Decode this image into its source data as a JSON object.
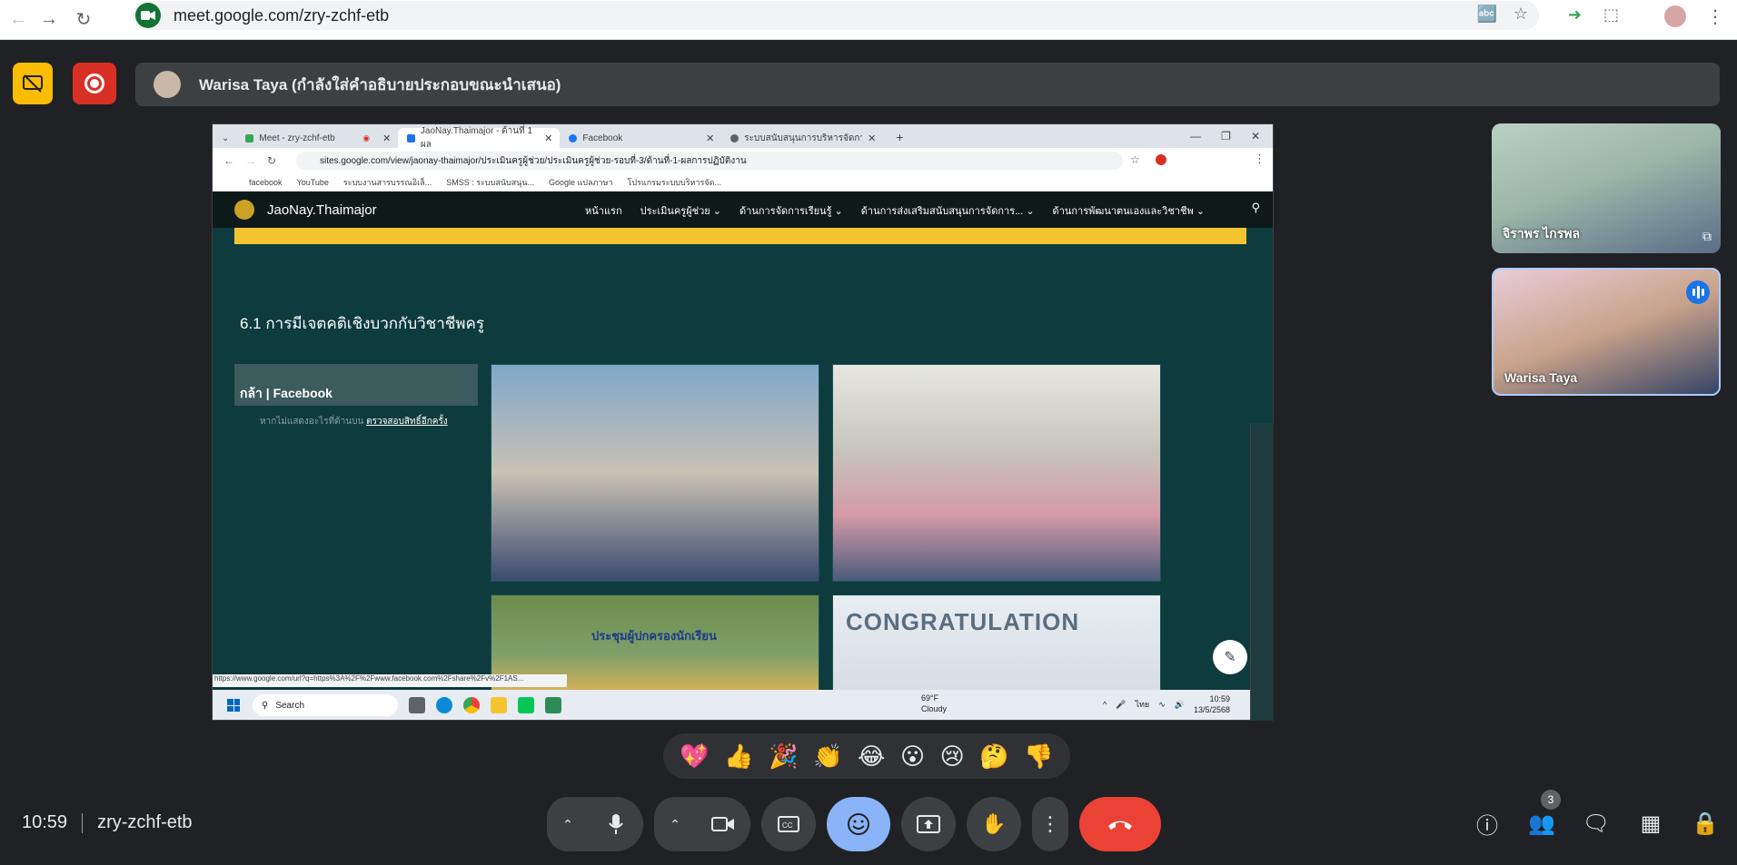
{
  "browser": {
    "url": "meet.google.com/zry-zchf-etb"
  },
  "presenter": {
    "banner_text": "Warisa Taya (กำลังใส่คำอธิบายประกอบขณะนำเสนอ)"
  },
  "shared_screen": {
    "tabs": [
      {
        "label": "Meet - zry-zchf-etb",
        "color": "#34a853"
      },
      {
        "label": "JaoNay.Thaimajor - ด้านที่ 1 ผล",
        "color": "#1a73e8"
      },
      {
        "label": "Facebook",
        "color": "#1877f2"
      },
      {
        "label": "ระบบสนับสนุนการบริหารจัดการสถาน",
        "color": "#5f6368"
      }
    ],
    "url": "sites.google.com/view/jaonay-thaimajor/ประเมินครูผู้ช่วย/ประเมินครูผู้ช่วย-รอบที่-3/ด้านที่-1-ผลการปฏิบัติงาน",
    "bookmarks": [
      "facebook",
      "YouTube",
      "ระบบงานสารบรรณอิเล็...",
      "SMSS : ระบบสนับสนุน...",
      "Google แปลภาษา",
      "โปรแกรมระบบบริหารจัด..."
    ],
    "site_name": "JaoNay.Thaimajor",
    "site_nav": [
      "หน้าแรก",
      "ประเมินครูผู้ช่วย ⌄",
      "ด้านการจัดการเรียนรู้ ⌄",
      "ด้านการส่งเสริมสนับสนุนการจัดการ... ⌄",
      "ด้านการพัฒนาตนเองและวิชาชีพ ⌄"
    ],
    "section_title": "6.1 การมีเจตคติเชิงบวกกับวิชาชีพครู",
    "fb_label": "กล้า | Facebook",
    "fb_sub": "หากไม่แสดงอะไรที่ด้านบน",
    "fb_link": "ตรวจสอบสิทธิ์อีกครั้ง",
    "photo3_caption": "ประชุมผู้ปกครองนักเรียน",
    "photo4_caption": "CONGRATULATION",
    "status_url": "https://www.google.com/url?q=https%3A%2F%2Fwww.facebook.com%2Fshare%2Fv%2F1AS...",
    "taskbar": {
      "search": "Search",
      "weather_temp": "69°F",
      "weather_cond": "Cloudy",
      "lang": "ไทย",
      "time": "10:59",
      "date": "13/5/2568"
    }
  },
  "participants": [
    {
      "name": "จิราพร ไกรพล"
    },
    {
      "name": "Warisa Taya"
    }
  ],
  "reactions": [
    "💖",
    "👍",
    "🎉",
    "👏",
    "😂",
    "😮",
    "😢",
    "🤔",
    "👎"
  ],
  "bottom": {
    "time": "10:59",
    "meeting_code": "zry-zchf-etb",
    "people_count": "3"
  }
}
